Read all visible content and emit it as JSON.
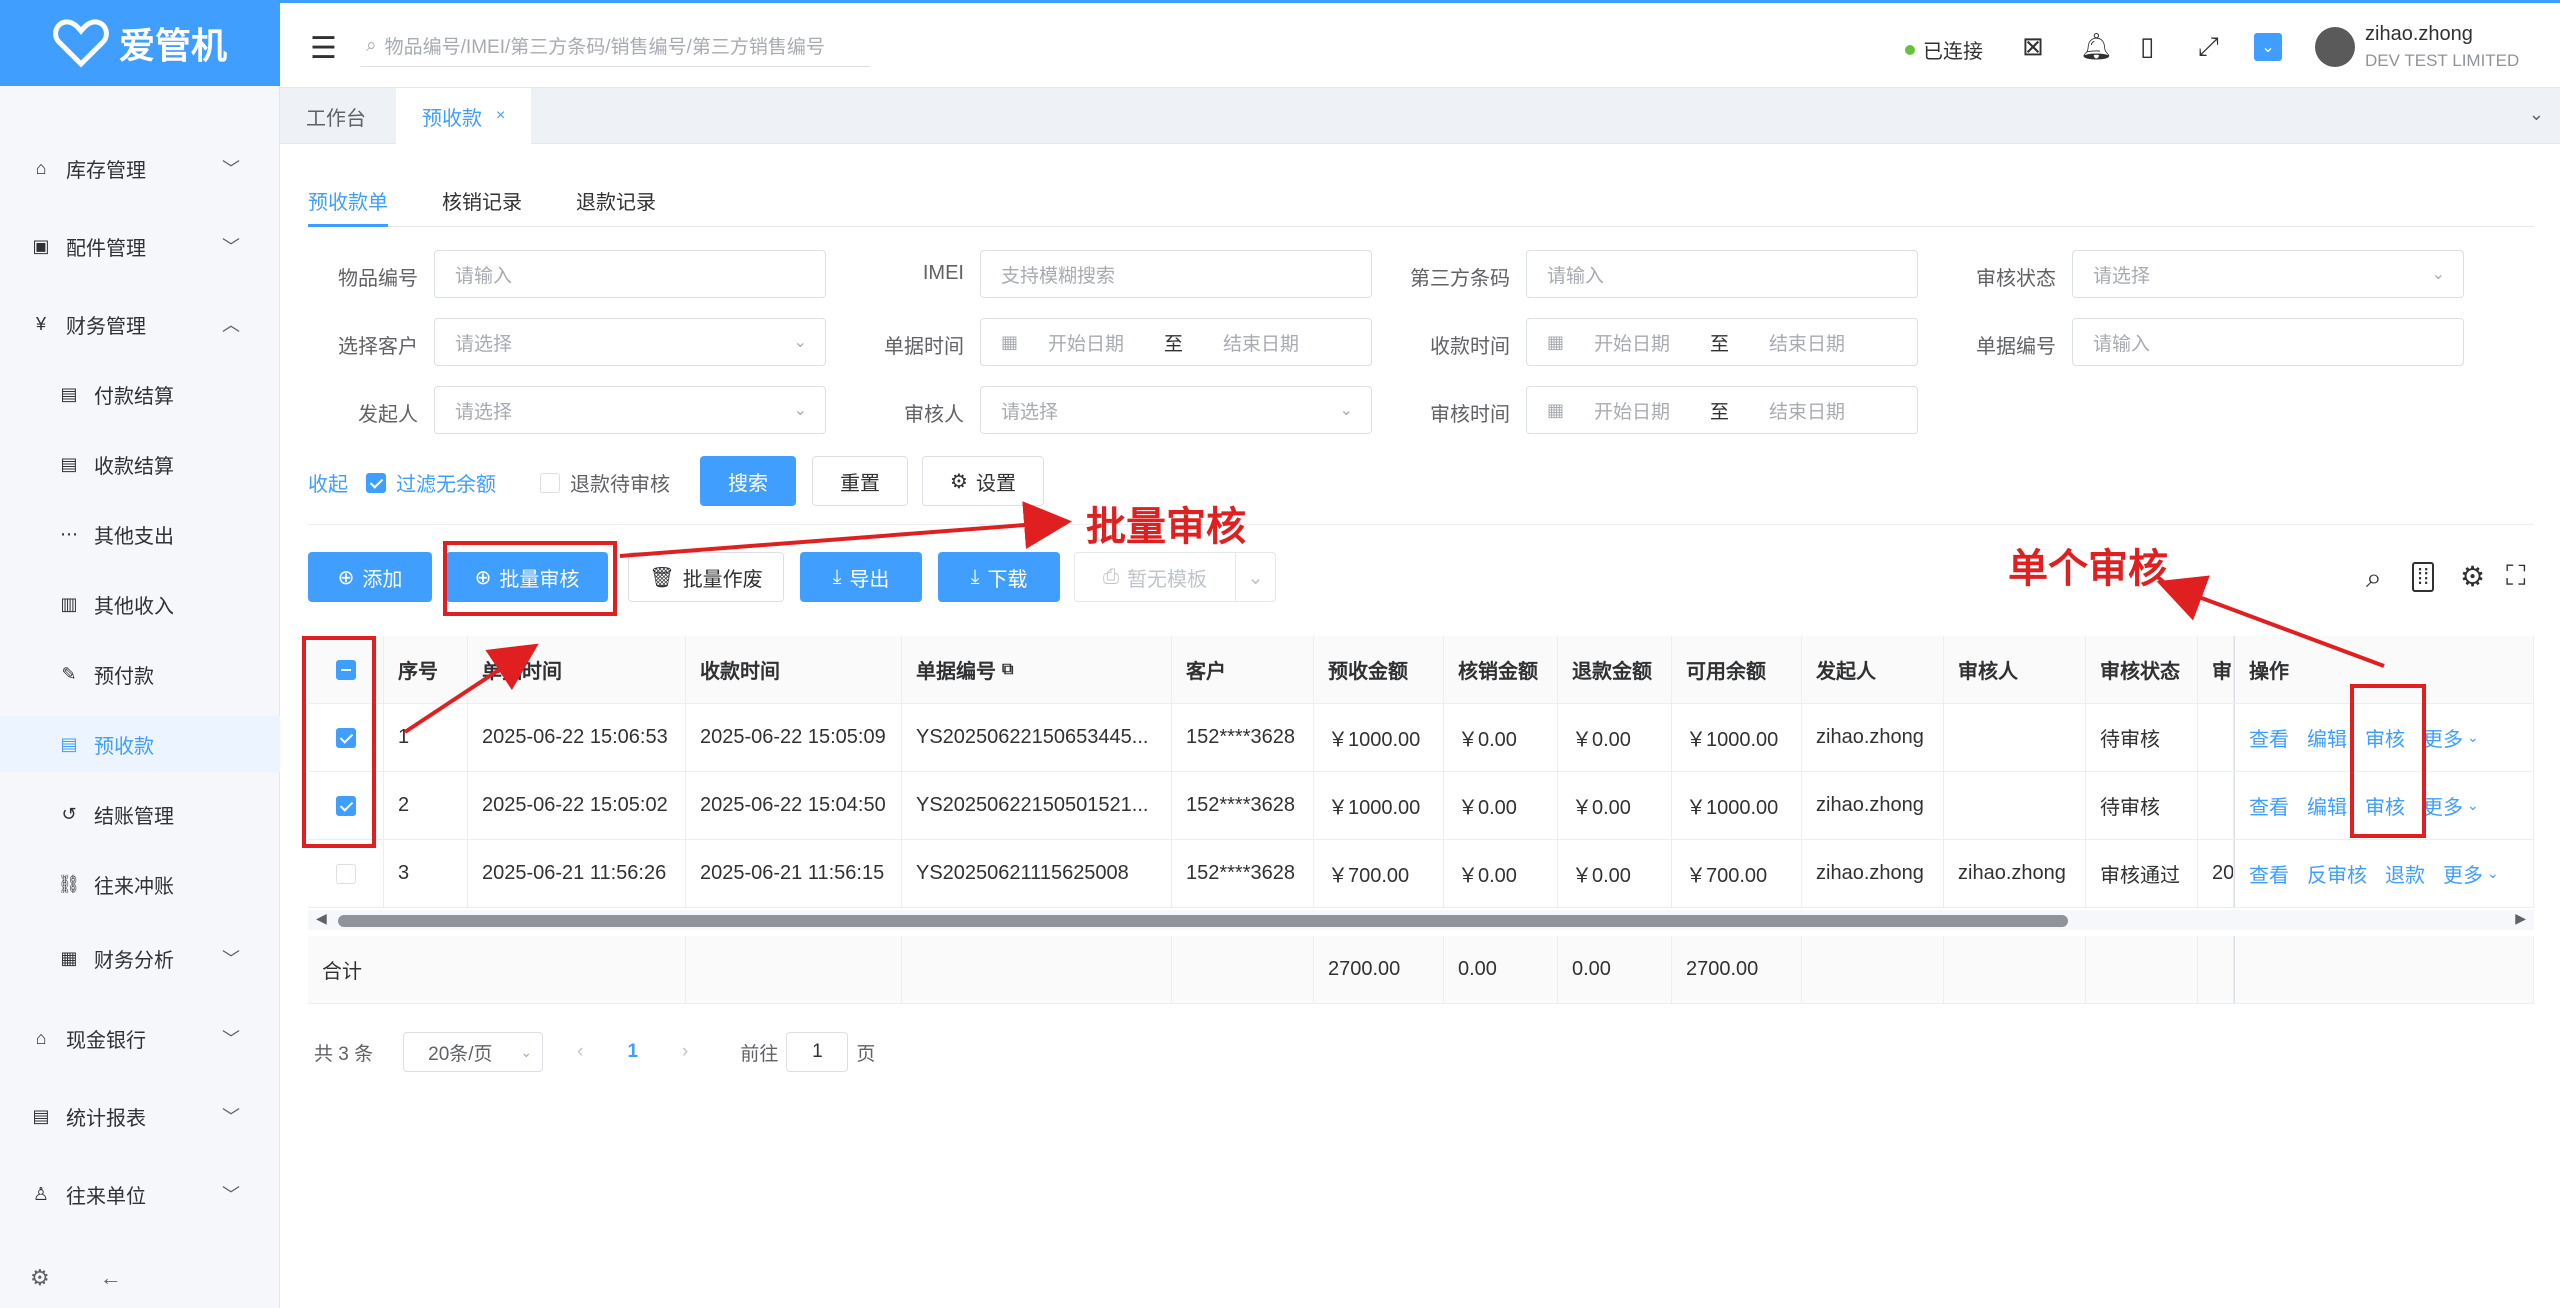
{
  "app": {
    "name": "爱管机"
  },
  "sidebar": {
    "items": [
      {
        "label": "库存管理",
        "icon": "home-icon",
        "expanded": false
      },
      {
        "label": "配件管理",
        "icon": "box-icon",
        "expanded": false
      },
      {
        "label": "财务管理",
        "icon": "yen-icon",
        "expanded": true
      },
      {
        "label": "付款结算",
        "icon": "doc-icon",
        "sub": true
      },
      {
        "label": "收款结算",
        "icon": "doc-icon",
        "sub": true
      },
      {
        "label": "其他支出",
        "icon": "dots-icon",
        "sub": true
      },
      {
        "label": "其他收入",
        "icon": "yen-doc-icon",
        "sub": true
      },
      {
        "label": "预付款",
        "icon": "pay-icon",
        "sub": true
      },
      {
        "label": "预收款",
        "icon": "doc-icon",
        "sub": true,
        "active": true
      },
      {
        "label": "结账管理",
        "icon": "history-icon",
        "sub": true
      },
      {
        "label": "往来冲账",
        "icon": "link-icon",
        "sub": true
      },
      {
        "label": "财务分析",
        "icon": "chart-icon",
        "sub": true,
        "expanded": false
      },
      {
        "label": "现金银行",
        "icon": "bank-icon",
        "expanded": false
      },
      {
        "label": "统计报表",
        "icon": "report-icon",
        "expanded": false
      },
      {
        "label": "往来单位",
        "icon": "users-icon",
        "expanded": false
      }
    ]
  },
  "header": {
    "search_placeholder": "物品编号/IMEI/第三方条码/销售编号/第三方销售编号",
    "status": "已连接",
    "user_name": "zihao.zhong",
    "company": "DEV TEST LIMITED"
  },
  "tabs": [
    {
      "label": "工作台"
    },
    {
      "label": "预收款"
    }
  ],
  "subtabs": [
    "预收款单",
    "核销记录",
    "退款记录"
  ],
  "form": {
    "item_no": {
      "label": "物品编号",
      "placeholder": "请输入"
    },
    "imei": {
      "label": "IMEI",
      "placeholder": "支持模糊搜索"
    },
    "third_code": {
      "label": "第三方条码",
      "placeholder": "请输入"
    },
    "audit_status": {
      "label": "审核状态",
      "placeholder": "请选择"
    },
    "customer": {
      "label": "选择客户",
      "placeholder": "请选择"
    },
    "bill_time": {
      "label": "单据时间",
      "start": "开始日期",
      "to": "至",
      "end": "结束日期"
    },
    "receive_time": {
      "label": "收款时间",
      "start": "开始日期",
      "to": "至",
      "end": "结束日期"
    },
    "bill_no": {
      "label": "单据编号",
      "placeholder": "请输入"
    },
    "initiator": {
      "label": "发起人",
      "placeholder": "请选择"
    },
    "auditor": {
      "label": "审核人",
      "placeholder": "请选择"
    },
    "audit_time": {
      "label": "审核时间",
      "start": "开始日期",
      "to": "至",
      "end": "结束日期"
    },
    "collapse": "收起",
    "filter_no_balance": "过滤无余额",
    "refund_pending": "退款待审核",
    "search_btn": "搜索",
    "reset_btn": "重置",
    "settings_btn": "设置"
  },
  "toolbar": {
    "add": "添加",
    "batch_audit": "批量审核",
    "batch_void": "批量作废",
    "export": "导出",
    "download": "下载",
    "no_template": "暂无模板"
  },
  "annotations": {
    "batch": "批量审核",
    "single": "单个审核"
  },
  "table": {
    "columns": [
      "序号",
      "单据时间",
      "收款时间",
      "单据编号",
      "客户",
      "预收金额",
      "核销金额",
      "退款金额",
      "可用余额",
      "发起人",
      "审核人",
      "审核状态",
      "审",
      "操作"
    ],
    "rows": [
      {
        "checked": true,
        "no": "1",
        "bill_time": "2025-06-22 15:06:53",
        "receive_time": "2025-06-22 15:05:09",
        "bill_no": "YS20250622150653445...",
        "customer": "152****3628",
        "prepaid": "￥1000.00",
        "written_off": "￥0.00",
        "refund": "￥0.00",
        "balance": "￥1000.00",
        "initiator": "zihao.zhong",
        "auditor": "",
        "status": "待审核",
        "extra": "",
        "ops": [
          "查看",
          "编辑",
          "审核",
          "更多"
        ]
      },
      {
        "checked": true,
        "no": "2",
        "bill_time": "2025-06-22 15:05:02",
        "receive_time": "2025-06-22 15:04:50",
        "bill_no": "YS20250622150501521...",
        "customer": "152****3628",
        "prepaid": "￥1000.00",
        "written_off": "￥0.00",
        "refund": "￥0.00",
        "balance": "￥1000.00",
        "initiator": "zihao.zhong",
        "auditor": "",
        "status": "待审核",
        "extra": "",
        "ops": [
          "查看",
          "编辑",
          "审核",
          "更多"
        ]
      },
      {
        "checked": false,
        "no": "3",
        "bill_time": "2025-06-21 11:56:26",
        "receive_time": "2025-06-21 11:56:15",
        "bill_no": "YS20250621115625008",
        "customer": "152****3628",
        "prepaid": "￥700.00",
        "written_off": "￥0.00",
        "refund": "￥0.00",
        "balance": "￥700.00",
        "initiator": "zihao.zhong",
        "auditor": "zihao.zhong",
        "status": "审核通过",
        "extra": "20",
        "ops": [
          "查看",
          "反审核",
          "退款",
          "更多"
        ]
      }
    ],
    "summary": {
      "label": "合计",
      "prepaid": "2700.00",
      "written_off": "0.00",
      "refund": "0.00",
      "balance": "2700.00"
    }
  },
  "pagination": {
    "total": "共 3 条",
    "page_size": "20条/页",
    "current": "1",
    "goto": "前往",
    "goto_value": "1",
    "page_unit": "页"
  },
  "colors": {
    "primary": "#409eff",
    "annotation": "#e02020",
    "online": "#67c23a"
  }
}
